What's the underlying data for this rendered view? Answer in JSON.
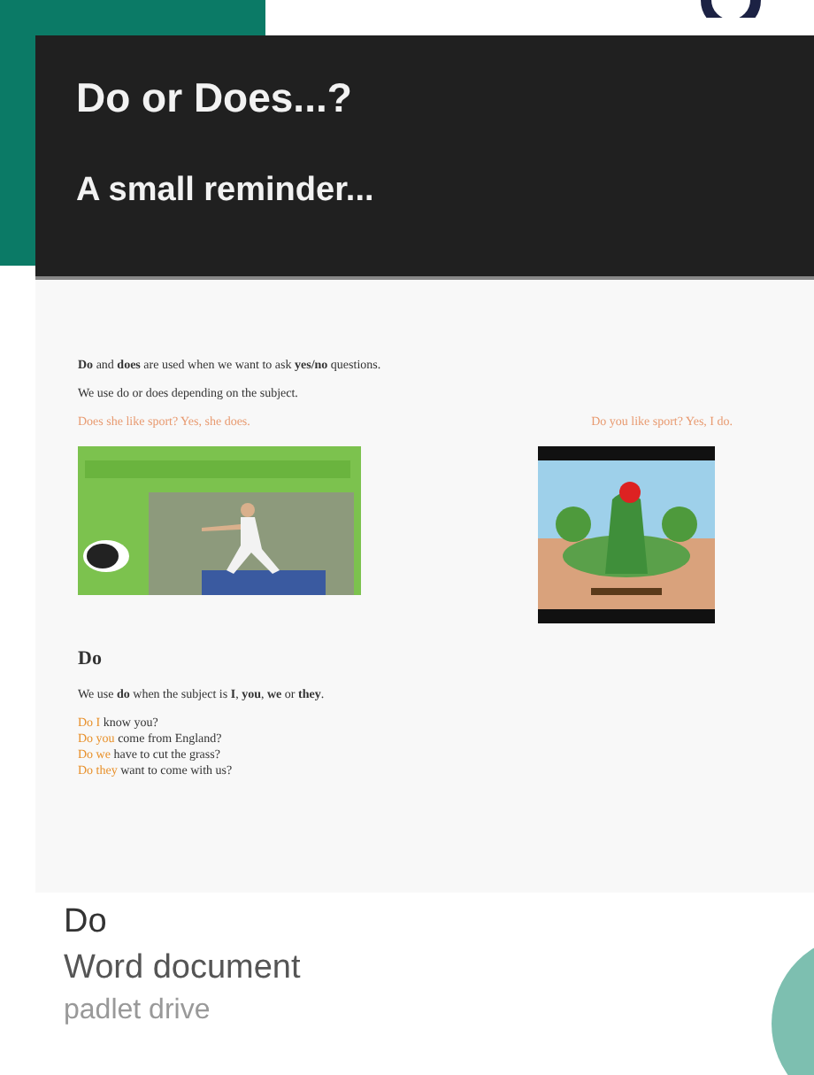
{
  "header": {
    "title": "Do or Does...?",
    "subtitle": "A small reminder..."
  },
  "document": {
    "intro": "**Do** and **does** are used when we want to ask **yes/no** questions.",
    "note": "We use do or does depending on the subject.",
    "examples": [
      {
        "text": "Does she like sport? Yes, she does."
      },
      {
        "text": "Do you like sport? Yes, I do."
      }
    ],
    "heading": "Do",
    "rule": "We use **do** when the subject is **I**, **you**, **we** or **they**.",
    "questions": [
      {
        "lead": "Do I",
        "rest": " know you?"
      },
      {
        "lead": "Do you",
        "rest": " come from England?"
      },
      {
        "lead": "Do we",
        "rest": " have to cut the grass?"
      },
      {
        "lead": "Do they",
        "rest": " want to come with us?"
      }
    ]
  },
  "caption": {
    "title": "Do",
    "type": "Word document",
    "source": "padlet drive"
  }
}
